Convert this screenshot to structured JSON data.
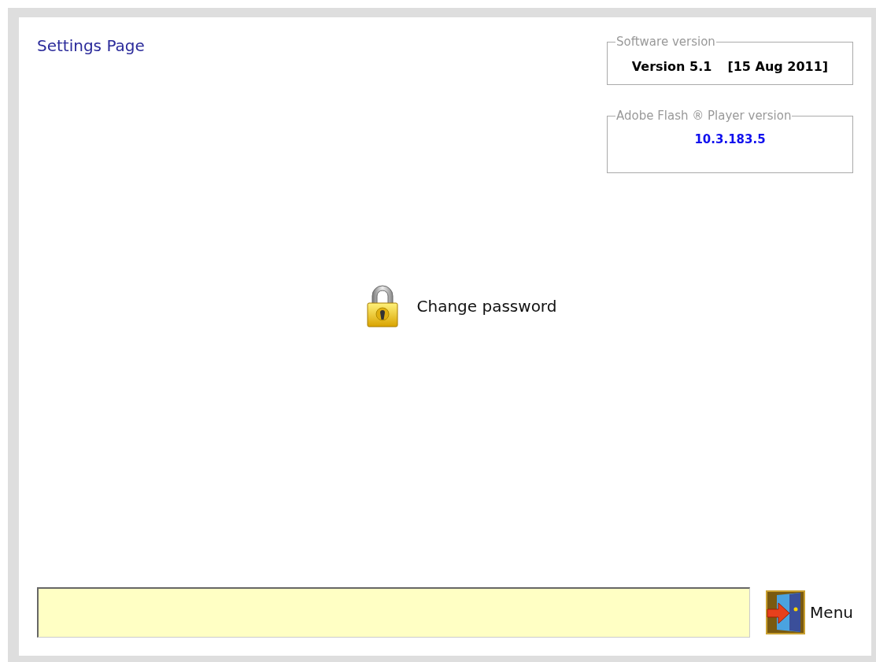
{
  "page": {
    "title": "Settings Page"
  },
  "software_version": {
    "legend": "Software version",
    "version": "Version 5.1",
    "date": "[15 Aug 2011]"
  },
  "flash_version": {
    "legend": "Adobe Flash ® Player version",
    "value": "10.3.183.5"
  },
  "actions": [
    {
      "label": "Change password"
    }
  ],
  "menu_button": {
    "label": "Menu"
  }
}
